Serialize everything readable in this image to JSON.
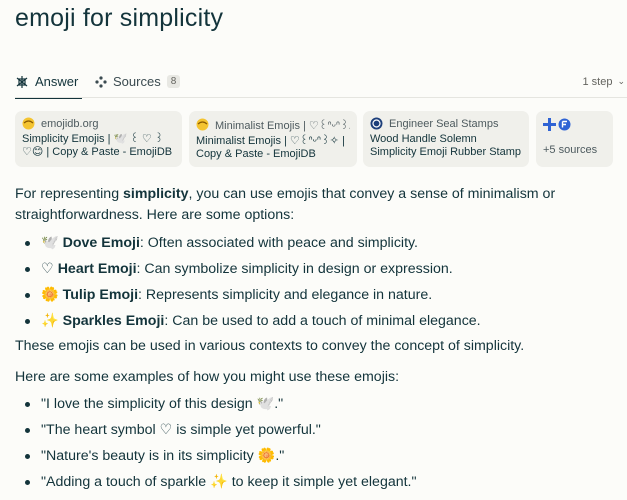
{
  "title": "emoji for simplicity",
  "tabs": {
    "answer_label": "Answer",
    "sources_label": "Sources",
    "sources_count": "8",
    "steps_label": "1 step"
  },
  "sources": [
    {
      "site": "emojidb.org",
      "title": "Simplicity Emojis | 🕊️ ꒰ ♡ ꒱ ♡😊 | Copy & Paste - EmojiDB"
    },
    {
      "site": "Minimalist Emojis | ♡⁠꒰⁠ᐢ⁠ᵕ⁠ᐢ⁠꒱...",
      "title": "Minimalist Emojis | ♡꒰ᐢᵕᐢ꒱✧ | Copy & Paste - EmojiDB"
    },
    {
      "site": "Engineer Seal Stamps",
      "title": "Wood Handle Solemn Simplicity Emoji Rubber Stamp"
    }
  ],
  "more_sources": "+5  sources",
  "intro_prefix": "For representing ",
  "intro_bold": "simplicity",
  "intro_suffix": ", you can use emojis that convey a sense of minimalism or straightforwardness. Here are some options:",
  "options": [
    {
      "emoji": "🕊️",
      "name": "Dove Emoji",
      "desc": ": Often associated with peace and simplicity."
    },
    {
      "emoji": "♡",
      "name": "Heart Emoji",
      "desc": ": Can symbolize simplicity in design or expression."
    },
    {
      "emoji": "🌼",
      "name": "Tulip Emoji",
      "desc": ": Represents simplicity and elegance in nature."
    },
    {
      "emoji": "✨",
      "name": "Sparkles Emoji",
      "desc": ": Can be used to add a touch of minimal elegance."
    }
  ],
  "summary": "These emojis can be used in various contexts to convey the concept of simplicity.",
  "examples_intro": "Here are some examples of how you might use these emojis:",
  "examples": [
    "\"I love the simplicity of this design 🕊️.\"",
    "\"The heart symbol ♡ is simple yet powerful.\"",
    "\"Nature's beauty is in its simplicity 🌼.\"",
    "\"Adding a touch of sparkle ✨ to keep it simple yet elegant.\""
  ]
}
